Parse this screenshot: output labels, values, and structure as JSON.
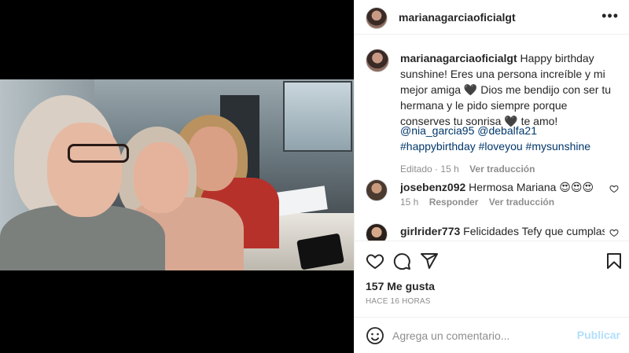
{
  "post": {
    "username": "marianagarciaoficialgt",
    "caption": {
      "username": "marianagarciaoficialgt",
      "text": "Happy birthday sunshine! Eres una persona increíble y mi mejor amiga 🖤 Dios me bendijo con ser tu hermana y le pido siempre porque conserves tu sonrisa 🖤 te amo!",
      "mentions": "@nia_garcia95 @debalfa21",
      "hashtags": "#happybirthday #loveyou #mysunshine",
      "edited": "Editado",
      "time": "15 h",
      "translate": "Ver traducción"
    },
    "comments": [
      {
        "username": "josebenz092",
        "text": "Hermosa Mariana 😍😍😍",
        "time": "15 h",
        "reply": "Responder",
        "translate": "Ver traducción"
      },
      {
        "username": "girlrider773",
        "text": "Felicidades Tefy que cumplas"
      }
    ],
    "likes": "157 Me gusta",
    "time_ago": "HACE 16 HORAS",
    "comment_box": {
      "placeholder": "Agrega un comentario...",
      "publish": "Publicar"
    }
  },
  "icons": {
    "more": "more-options-icon",
    "like": "heart-icon",
    "comment": "comment-icon",
    "share": "paper-plane-icon",
    "save": "bookmark-icon",
    "emoji": "emoji-icon"
  },
  "colors": {
    "link": "#00376b",
    "publish_disabled": "#b2dffc",
    "muted": "#8e8e8e"
  }
}
